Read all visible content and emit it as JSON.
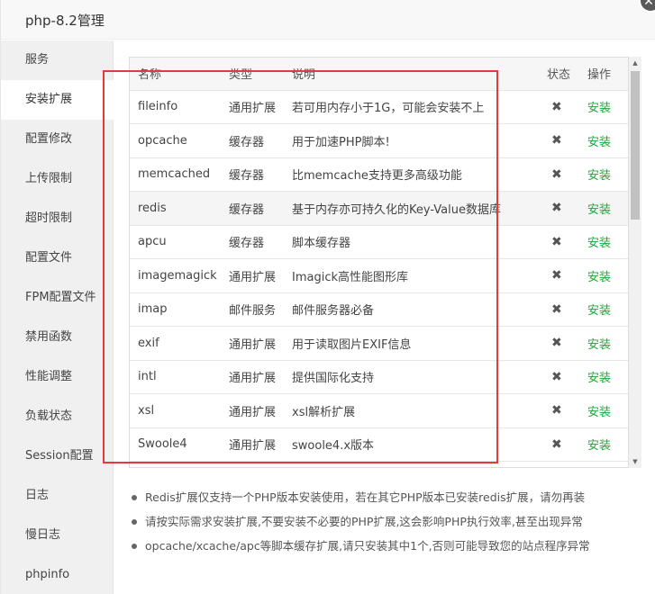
{
  "window": {
    "title": "php-8.2管理",
    "close_glyph": "✕"
  },
  "sidebar": {
    "items": [
      {
        "label": "服务"
      },
      {
        "label": "安装扩展",
        "active": true
      },
      {
        "label": "配置修改"
      },
      {
        "label": "上传限制"
      },
      {
        "label": "超时限制"
      },
      {
        "label": "配置文件"
      },
      {
        "label": "FPM配置文件"
      },
      {
        "label": "禁用函数"
      },
      {
        "label": "性能调整"
      },
      {
        "label": "负载状态"
      },
      {
        "label": "Session配置"
      },
      {
        "label": "日志"
      },
      {
        "label": "慢日志"
      },
      {
        "label": "phpinfo"
      }
    ]
  },
  "table": {
    "headers": {
      "name": "名称",
      "type": "类型",
      "desc": "说明",
      "status": "状态",
      "op": "操作"
    },
    "rows": [
      {
        "name": "fileinfo",
        "type": "通用扩展",
        "desc": "若可用内存小于1G，可能会安装不上",
        "status": "✖",
        "op": "安装"
      },
      {
        "name": "opcache",
        "type": "缓存器",
        "desc": "用于加速PHP脚本!",
        "status": "✖",
        "op": "安装"
      },
      {
        "name": "memcached",
        "type": "缓存器",
        "desc": "比memcache支持更多高级功能",
        "status": "✖",
        "op": "安装"
      },
      {
        "name": "redis",
        "type": "缓存器",
        "desc": "基于内存亦可持久化的Key-Value数据库",
        "status": "✖",
        "op": "安装"
      },
      {
        "name": "apcu",
        "type": "缓存器",
        "desc": "脚本缓存器",
        "status": "✖",
        "op": "安装"
      },
      {
        "name": "imagemagick",
        "type": "通用扩展",
        "desc": "Imagick高性能图形库",
        "status": "✖",
        "op": "安装"
      },
      {
        "name": "imap",
        "type": "邮件服务",
        "desc": "邮件服务器必备",
        "status": "✖",
        "op": "安装"
      },
      {
        "name": "exif",
        "type": "通用扩展",
        "desc": "用于读取图片EXIF信息",
        "status": "✖",
        "op": "安装"
      },
      {
        "name": "intl",
        "type": "通用扩展",
        "desc": "提供国际化支持",
        "status": "✖",
        "op": "安装"
      },
      {
        "name": "xsl",
        "type": "通用扩展",
        "desc": "xsl解析扩展",
        "status": "✖",
        "op": "安装"
      },
      {
        "name": "Swoole4",
        "type": "通用扩展",
        "desc": "swoole4.x版本",
        "status": "✖",
        "op": "安装"
      }
    ]
  },
  "tips": [
    "Redis扩展仅支持一个PHP版本安装使用，若在其它PHP版本已安装redis扩展，请勿再装",
    "请按实际需求安装扩展,不要安装不必要的PHP扩展,这会影响PHP执行效率,甚至出现异常",
    "opcache/xcache/apc等脚本缓存扩展,请只安装其中1个,否则可能导致您的站点程序异常"
  ],
  "colors": {
    "accent_green": "#20a53a",
    "highlight_red": "#e03c3c"
  }
}
